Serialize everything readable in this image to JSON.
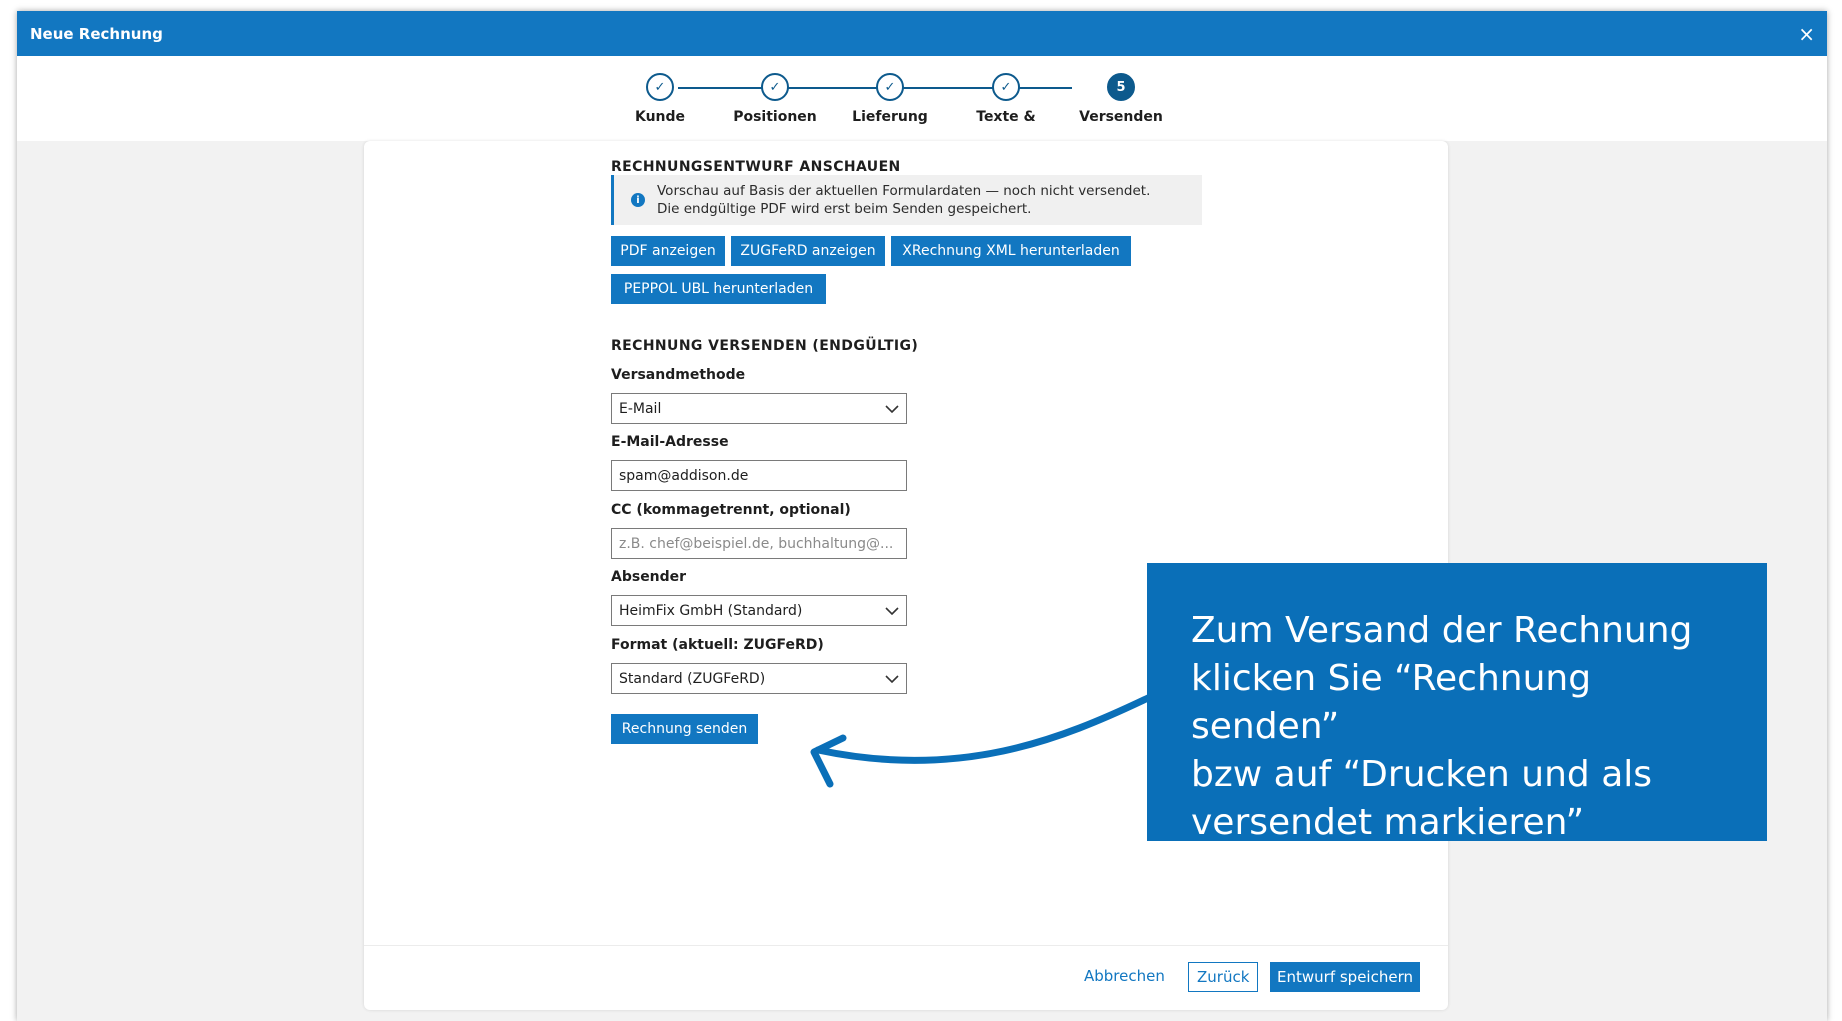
{
  "window": {
    "title": "Neue Rechnung",
    "close_glyph": "×"
  },
  "stepper": {
    "steps": [
      {
        "label": "Kunde",
        "state": "done",
        "glyph": "✓"
      },
      {
        "label": "Positionen",
        "state": "done",
        "glyph": "✓"
      },
      {
        "label": "Lieferung",
        "state": "done",
        "glyph": "✓"
      },
      {
        "label": "Texte &",
        "state": "done",
        "glyph": "✓"
      },
      {
        "label": "Versenden",
        "state": "active",
        "glyph": "5"
      }
    ]
  },
  "preview": {
    "title": "RECHNUNGSENTWURF ANSCHAUEN",
    "info_icon": "info-icon",
    "info_line1": "Vorschau auf Basis der aktuellen Formulardaten — noch nicht versendet.",
    "info_line2": "Die endgültige PDF wird erst beim Senden gespeichert.",
    "buttons": {
      "pdf": "PDF anzeigen",
      "zugferd": "ZUGFeRD anzeigen",
      "xrechnung": "XRechnung XML herunterladen",
      "peppol": "PEPPOL UBL herunterladen"
    }
  },
  "send": {
    "title": "RECHNUNG VERSENDEN (ENDGÜLTIG)",
    "method_label": "Versandmethode",
    "method_value": "E-Mail",
    "email_label": "E-Mail-Adresse",
    "email_value": "spam@addison.de",
    "cc_label": "CC (kommagetrennt, optional)",
    "cc_placeholder": "z.B. chef@beispiel.de, buchhaltung@...",
    "sender_label": "Absender",
    "sender_value": "HeimFix GmbH (Standard)",
    "format_label": "Format (aktuell: ZUGFeRD)",
    "format_value": "Standard (ZUGFeRD)",
    "submit": "Rechnung senden"
  },
  "footer": {
    "cancel": "Abbrechen",
    "back": "Zurück",
    "save_draft": "Entwurf speichern"
  },
  "callout": {
    "line1": "Zum Versand der Rechnung",
    "line2": "klicken Sie “Rechnung senden”",
    "line3": "bzw auf “Drucken und als",
    "line4": "versendet markieren”"
  },
  "colors": {
    "primary": "#1277c1",
    "step_dark": "#0d5a8d",
    "callout_bg": "#0a6fb8",
    "page_bg": "#f2f2f2"
  }
}
